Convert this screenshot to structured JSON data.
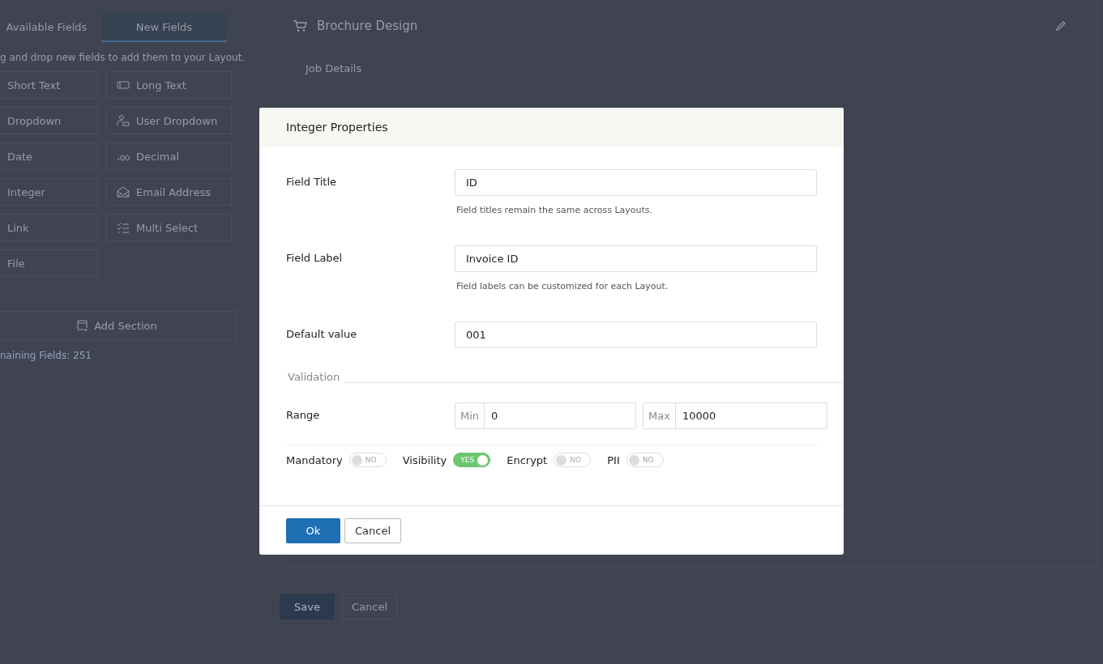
{
  "sidebar": {
    "tabs": [
      {
        "label": "Available Fields",
        "selected": false
      },
      {
        "label": "New Fields",
        "selected": true
      }
    ],
    "hint": "g and drop new fields to add them to your Layout.",
    "fields": [
      {
        "label": "Short Text",
        "kind": "short_text"
      },
      {
        "label": "Long Text",
        "kind": "long_text"
      },
      {
        "label": "Dropdown",
        "kind": "dropdown"
      },
      {
        "label": "User Dropdown",
        "kind": "user_dropdown"
      },
      {
        "label": "Date",
        "kind": "date"
      },
      {
        "label": "Decimal",
        "kind": "decimal"
      },
      {
        "label": "Integer",
        "kind": "integer"
      },
      {
        "label": "Email Address",
        "kind": "email"
      },
      {
        "label": "Link",
        "kind": "link"
      },
      {
        "label": "Multi Select",
        "kind": "multi_select"
      },
      {
        "label": "File",
        "kind": "file"
      }
    ],
    "add_section": "Add Section",
    "remaining": "naining Fields: 251"
  },
  "layout": {
    "title": "Brochure Design",
    "section": "Job Details",
    "buttons": [
      {
        "label": "Save",
        "kind": "primary"
      },
      {
        "label": "Cancel",
        "kind": "secondary"
      }
    ]
  },
  "dialog": {
    "title": "Integer Properties",
    "rows": [
      {
        "label": "Field Title",
        "value": "ID",
        "help": "Field titles remain the same across Layouts."
      },
      {
        "label": "Field Label",
        "value": "Invoice ID",
        "help": "Field labels can be customized for each Layout."
      },
      {
        "label": "Default value",
        "value": "001"
      }
    ],
    "validation": "Validation",
    "range": {
      "label": "Range",
      "min_label": "Min",
      "min": "0",
      "max_label": "Max",
      "max": "10000"
    },
    "toggles": [
      {
        "label": "Mandatory",
        "on": false,
        "text": "NO"
      },
      {
        "label": "Visibility",
        "on": true,
        "text": "YES"
      },
      {
        "label": "Encrypt",
        "on": false,
        "text": "NO"
      },
      {
        "label": "PII",
        "on": false,
        "text": "NO"
      }
    ],
    "buttons": [
      {
        "label": "Ok",
        "kind": "primary"
      },
      {
        "label": "Cancel",
        "kind": "secondary"
      }
    ]
  }
}
